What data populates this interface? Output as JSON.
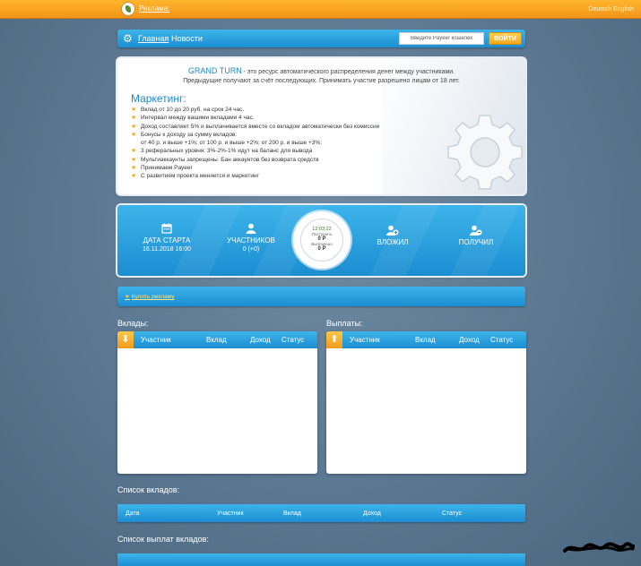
{
  "topbar": {
    "ad_label": "Реклама:",
    "lang_label": "Deutsch English"
  },
  "nav": {
    "home": "Главная",
    "news": "Новости",
    "wallet_placeholder": "Введите Payeer кошелёк",
    "login": "ВОЙТИ"
  },
  "info": {
    "brand": "GRAND TURN",
    "intro_rest": " - это ресурс автоматического распределения денег между участниками.",
    "intro_line2": "Предыдущие получают за счёт последующих. Принимать участие разрешено лицам от 18 лет.",
    "marketing_title": "Маркетинг:",
    "items": [
      {
        "text": "Вклад от 10 до 20 руб. на срок 24 час.",
        "star": true
      },
      {
        "text": "Интервал между вашими вкладами 4 час.",
        "star": true
      },
      {
        "text": "Доход составляет 5% и выплачивается вместе со вкладом автоматически без комиссии",
        "star": true
      },
      {
        "text": "Бонусы к доходу за сумму вкладов:",
        "star": true
      },
      {
        "text": "от 40 р. и выше +1%; от 100 р. и выше +2%; от 200 р. и выше +3%;",
        "star": false
      },
      {
        "text": "3 реферальных уровня: 3%-2%-1% идут на баланс для вывода",
        "star": true
      },
      {
        "text": "Мультиаккаунты запрещены. Бан аккаунтов без возврата средств",
        "star": true
      },
      {
        "text": "Принимаем Payeer",
        "star": true
      },
      {
        "text": "С развитием проекта меняется и маркетинг",
        "star": true
      }
    ]
  },
  "stats": {
    "start_label": "ДАТА СТАРТА",
    "start_value": "16.11.2018 16:00",
    "members_label": "УЧАСТНИКОВ",
    "members_value": "0 (+0)",
    "clock_time": "12:03:22",
    "clock_received_label": "Поступило",
    "clock_received_value": "0 P",
    "clock_paid_label": "Выплачено",
    "clock_paid_value": "0 P",
    "invested_label": "ВЛОЖИЛ",
    "received_label": "ПОЛУЧИЛ"
  },
  "buy_ad": "Купить рекламу",
  "deposits": {
    "title": "Вклады:",
    "columns": [
      "Участник",
      "Вклад",
      "Доход",
      "Статус"
    ]
  },
  "payouts": {
    "title": "Выплаты:",
    "columns": [
      "Участник",
      "Вклад",
      "Доход",
      "Статус"
    ]
  },
  "deposit_list": {
    "title": "Список вкладов:",
    "columns": [
      "Дата",
      "Участник",
      "Вклад",
      "Доход",
      "Статус"
    ]
  },
  "payout_list": {
    "title": "Список выплат вкладов:"
  }
}
